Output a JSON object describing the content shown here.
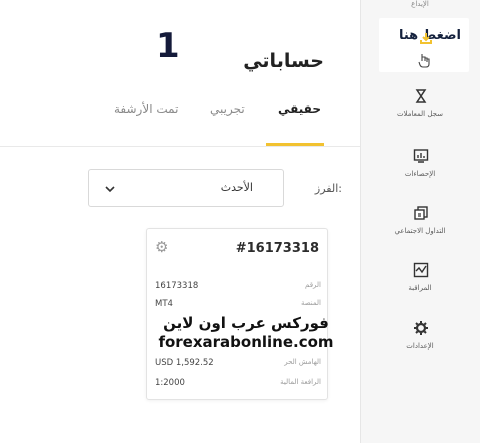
{
  "annotation": {
    "step": "1",
    "hint": "اضغط هنا"
  },
  "page": {
    "title": "حساباتي"
  },
  "tabs": [
    {
      "label": "حقيقي",
      "active": true
    },
    {
      "label": "تجريبي",
      "active": false
    },
    {
      "label": "تمت الأرشفة",
      "active": false
    }
  ],
  "sort": {
    "label": "الفرز:",
    "value": "الأحدث"
  },
  "account_card": {
    "title": "#16173318",
    "rows": [
      {
        "label": "الرقم",
        "value": "16173318"
      },
      {
        "label": "المنصة",
        "value": "MT4"
      },
      {
        "label": "الهامش الحر",
        "value": "USD 1,592.52"
      },
      {
        "label": "الرافعة المالية",
        "value": "1:2000"
      }
    ]
  },
  "watermark": {
    "line1": "فوركس عرب اون لاين",
    "line2": "forexarabonline.com"
  },
  "sidebar": {
    "top_label": "الإيداع",
    "items": [
      {
        "label": "سجل المعاملات",
        "icon": "hourglass-icon"
      },
      {
        "label": "الإحصاءات",
        "icon": "statistics-icon"
      },
      {
        "label": "التداول الاجتماعي",
        "icon": "social-trading-icon"
      },
      {
        "label": "المراقبة",
        "icon": "monitoring-icon"
      },
      {
        "label": "الإعدادات",
        "icon": "gear-icon"
      }
    ]
  },
  "colors": {
    "accent": "#f2c230",
    "text": "#1f1f1f",
    "muted": "#8a8a8a",
    "sidebar_bg": "#f6f6f6"
  }
}
